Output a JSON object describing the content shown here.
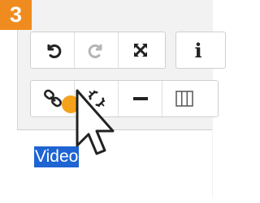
{
  "step": {
    "number": "3"
  },
  "toolbar_row1": {
    "buttons": [
      {
        "name": "undo",
        "icon": "undo-icon",
        "enabled": true
      },
      {
        "name": "redo",
        "icon": "redo-icon",
        "enabled": false
      },
      {
        "name": "fullscreen",
        "icon": "fullscreen-icon",
        "enabled": true
      }
    ],
    "info": {
      "icon": "info-icon",
      "glyph": "i"
    }
  },
  "toolbar_row2": {
    "buttons": [
      {
        "name": "insert-link",
        "icon": "link-icon",
        "active_click": true
      },
      {
        "name": "remove-link",
        "icon": "unlink-icon"
      },
      {
        "name": "horizontal-rule",
        "icon": "horizontal-rule-icon"
      },
      {
        "name": "table",
        "icon": "table-icon"
      }
    ]
  },
  "editor": {
    "selected_text": "Video"
  },
  "colors": {
    "badge": "#f08c1f",
    "selection": "#1e64d2",
    "click_indicator": "#f5a11c"
  }
}
